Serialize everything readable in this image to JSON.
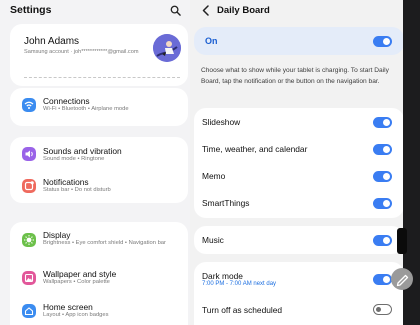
{
  "left": {
    "title": "Settings",
    "account": {
      "name": "John Adams",
      "sub": "Samsung account  ·  joh************@gmail.com"
    },
    "items": [
      {
        "title": "Connections",
        "sub": "Wi-Fi  •  Bluetooth  •  Airplane mode",
        "icon": "wifi-icon",
        "color": "#3b8cf0"
      },
      {
        "title": "Sounds and vibration",
        "sub": "Sound mode  •  Ringtone",
        "icon": "speaker-icon",
        "color": "#9a63e8"
      },
      {
        "title": "Notifications",
        "sub": "Status bar  •  Do not disturb",
        "icon": "bell-icon",
        "color": "#ef6a5e"
      },
      {
        "title": "Display",
        "sub": "Brightness  •  Eye comfort shield  •  Navigation bar",
        "icon": "sun-icon",
        "color": "#6cc04a"
      },
      {
        "title": "Wallpaper and style",
        "sub": "Wallpapers  •  Color palette",
        "icon": "picture-icon",
        "color": "#e2579a"
      },
      {
        "title": "Home screen",
        "sub": "Layout  •  App icon badges",
        "icon": "home-icon",
        "color": "#3b8cf0"
      }
    ]
  },
  "right": {
    "title": "Daily Board",
    "on_label": "On",
    "on_value": true,
    "description": "Choose what to show while your tablet is charging. To start Daily Board, tap the notification or the button on the navigation bar.",
    "group1": [
      {
        "label": "Slideshow",
        "on": true
      },
      {
        "label": "Time, weather, and calendar",
        "on": true
      },
      {
        "label": "Memo",
        "on": true
      },
      {
        "label": "SmartThings",
        "on": true
      }
    ],
    "music": {
      "label": "Music",
      "on": true
    },
    "dark_mode": {
      "label": "Dark mode",
      "sub": "7:00 PM - 7:00 AM next day",
      "on": true
    },
    "turn_off": {
      "label": "Turn off as scheduled",
      "on": false
    }
  },
  "colors": {
    "accent": "#3a7df2",
    "on_bar": "#e4ecf9",
    "on_text": "#1b5fd1",
    "avatar": "#6a6bd6"
  }
}
